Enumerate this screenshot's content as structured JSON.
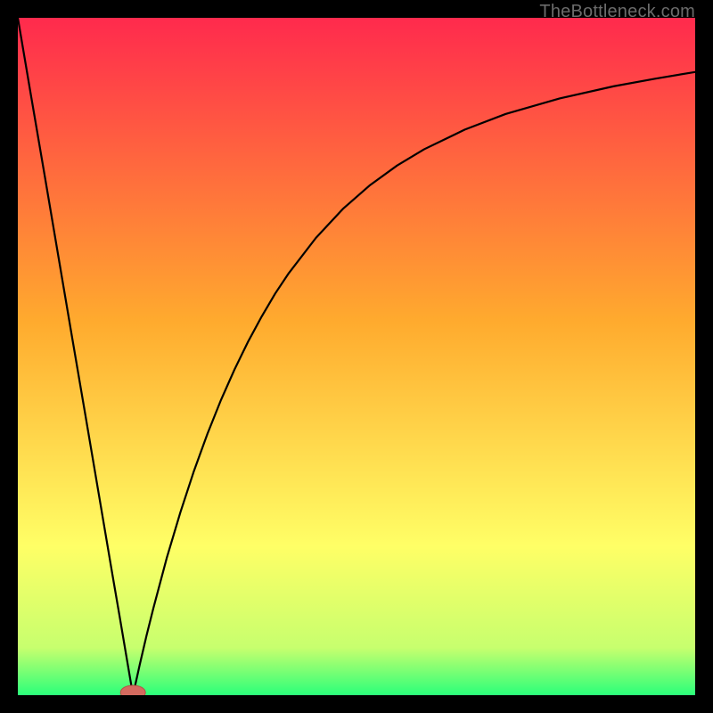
{
  "watermark": "TheBottleneck.com",
  "colors": {
    "frame": "#000000",
    "grad_top": "#ff2a4d",
    "grad_mid": "#ffab2e",
    "grad_low": "#ffff66",
    "grad_green_a": "#c7ff6e",
    "grad_green_b": "#2bff7a",
    "curve": "#000000",
    "marker_fill": "#d46a5f",
    "marker_stroke": "#b74f45"
  },
  "chart_data": {
    "type": "line",
    "title": "",
    "xlabel": "",
    "ylabel": "",
    "xlim": [
      0,
      100
    ],
    "ylim": [
      0,
      100
    ],
    "grid": false,
    "legend": false,
    "min_marker": {
      "x": 17,
      "y": 0
    },
    "series": [
      {
        "name": "bottleneck-curve",
        "x": [
          0,
          2,
          4,
          6,
          8,
          10,
          12,
          14,
          15,
          16,
          17,
          18,
          19,
          20,
          22,
          24,
          26,
          28,
          30,
          32,
          34,
          36,
          38,
          40,
          44,
          48,
          52,
          56,
          60,
          66,
          72,
          80,
          88,
          94,
          100
        ],
        "y": [
          100,
          88.2,
          76.5,
          64.7,
          52.9,
          41.2,
          29.4,
          17.6,
          11.8,
          5.9,
          0,
          4.5,
          8.8,
          12.8,
          20.3,
          27.0,
          33.1,
          38.6,
          43.6,
          48.1,
          52.2,
          55.9,
          59.3,
          62.3,
          67.5,
          71.8,
          75.3,
          78.2,
          80.6,
          83.5,
          85.8,
          88.1,
          89.9,
          91.0,
          92.0
        ]
      }
    ]
  }
}
